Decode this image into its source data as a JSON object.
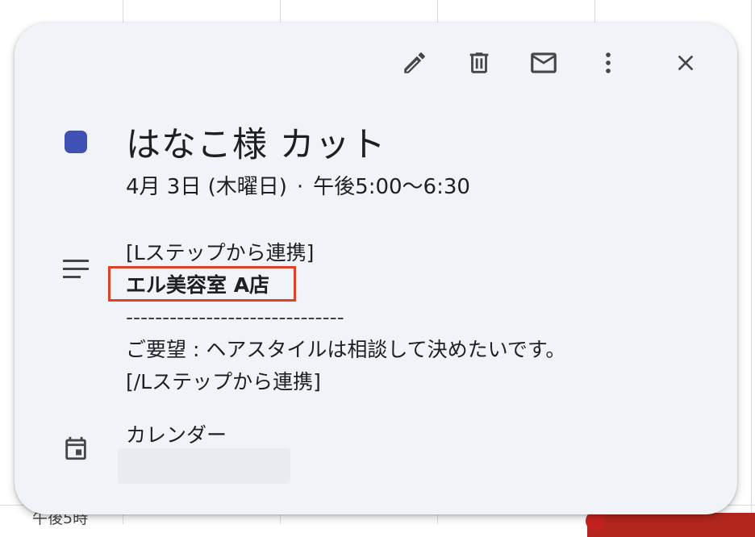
{
  "background": {
    "time_label": "午後5時"
  },
  "toolbar": {
    "edit_icon": "pencil-icon",
    "delete_icon": "trash-icon",
    "email_icon": "mail-icon",
    "more_icon": "more-vert-icon",
    "close_icon": "close-icon"
  },
  "event": {
    "color": "#3f51b5",
    "title": "はなこ様 カット",
    "date": "4月 3日 (木曜日)",
    "separator": "·",
    "time": "午後5:00〜6:30",
    "description": {
      "line1": "[Lステップから連携]",
      "line2": "エル美容室 A店",
      "line3": "------------------------------",
      "line4": "ご要望 : ヘアスタイルは相談して決めたいです。",
      "line5": "[/Lステップから連携]"
    },
    "calendar_label": "カレンダー"
  },
  "colors": {
    "card_bg": "#f0f4f9",
    "highlight": "#e0412b"
  }
}
